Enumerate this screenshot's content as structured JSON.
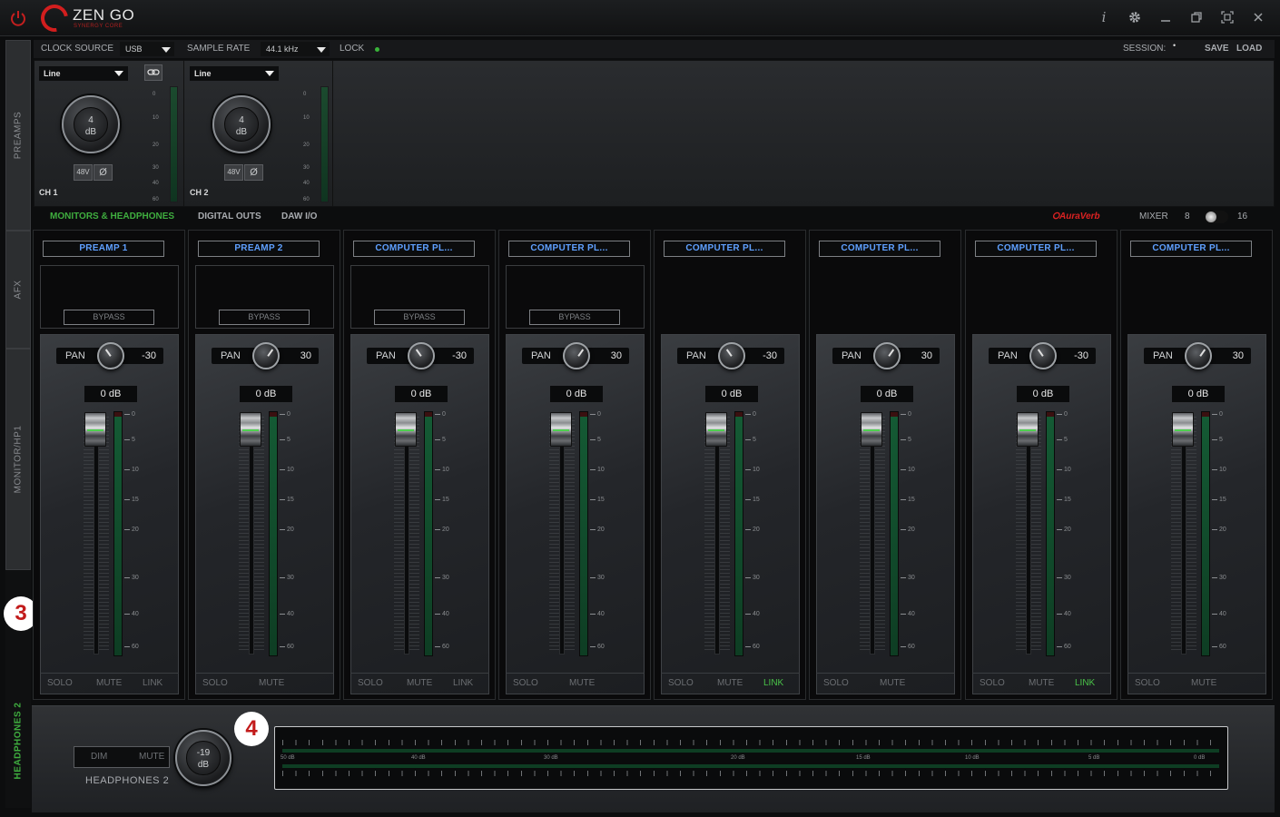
{
  "app": {
    "logo_text": "ZEN GO",
    "logo_sub": "SYNERGY CORE",
    "window_buttons": [
      "info-icon",
      "gear-icon",
      "minimize-icon",
      "restore-icon",
      "fullscreen-icon",
      "close-icon"
    ]
  },
  "sidebar": {
    "tabs": [
      {
        "label": "PREAMPS"
      },
      {
        "label": "AFX"
      },
      {
        "label": "MONITOR/HP1"
      },
      {
        "label": "HEADPHONES 2"
      }
    ]
  },
  "callouts": {
    "a": "3",
    "b": "4"
  },
  "controlbar": {
    "clock_source_label": "CLOCK SOURCE",
    "clock_source_value": "USB",
    "sample_rate_label": "SAMPLE RATE",
    "sample_rate_value": "44.1 kHz",
    "lock_label": "LOCK",
    "session_label": "SESSION:",
    "save_label": "SAVE",
    "load_label": "LOAD"
  },
  "preamps": [
    {
      "input": "Line",
      "gain": "4",
      "unit": "dB",
      "phantom": "48V",
      "phase": "Ø",
      "label": "CH 1"
    },
    {
      "input": "Line",
      "gain": "4",
      "unit": "dB",
      "phantom": "48V",
      "phase": "Ø",
      "label": "CH 2"
    }
  ],
  "preamp_scale": [
    "0",
    "10",
    "20",
    "30",
    "40",
    "60"
  ],
  "section_tabs": {
    "monitors": "MONITORS & HEADPHONES",
    "digital": "DIGITAL OUTS",
    "daw": "DAW I/O",
    "auraverb": "AuraVerb",
    "mixer_label": "MIXER",
    "mixer_8": "8",
    "mixer_16": "16"
  },
  "strips": [
    {
      "name": "PREAMP 1",
      "bypass": "BYPASS",
      "pan_label": "PAN",
      "pan": "-30",
      "gain": "0 dB",
      "solo": "SOLO",
      "mute": "MUTE",
      "link": "LINK",
      "link_on": false
    },
    {
      "name": "PREAMP 2",
      "bypass": "BYPASS",
      "pan_label": "PAN",
      "pan": "30",
      "gain": "0 dB",
      "solo": "SOLO",
      "mute": "MUTE",
      "link": "",
      "link_on": false
    },
    {
      "name": "COMPUTER PL...",
      "bypass": "BYPASS",
      "pan_label": "PAN",
      "pan": "-30",
      "gain": "0 dB",
      "solo": "SOLO",
      "mute": "MUTE",
      "link": "LINK",
      "link_on": false
    },
    {
      "name": "COMPUTER PL...",
      "bypass": "BYPASS",
      "pan_label": "PAN",
      "pan": "30",
      "gain": "0 dB",
      "solo": "SOLO",
      "mute": "MUTE",
      "link": "",
      "link_on": false
    },
    {
      "name": "COMPUTER PL...",
      "bypass": "",
      "pan_label": "PAN",
      "pan": "-30",
      "gain": "0 dB",
      "solo": "SOLO",
      "mute": "MUTE",
      "link": "LINK",
      "link_on": true
    },
    {
      "name": "COMPUTER PL...",
      "bypass": "",
      "pan_label": "PAN",
      "pan": "30",
      "gain": "0 dB",
      "solo": "SOLO",
      "mute": "MUTE",
      "link": "",
      "link_on": false
    },
    {
      "name": "COMPUTER PL...",
      "bypass": "",
      "pan_label": "PAN",
      "pan": "-30",
      "gain": "0 dB",
      "solo": "SOLO",
      "mute": "MUTE",
      "link": "LINK",
      "link_on": true
    },
    {
      "name": "COMPUTER PL...",
      "bypass": "",
      "pan_label": "PAN",
      "pan": "30",
      "gain": "0 dB",
      "solo": "SOLO",
      "mute": "MUTE",
      "link": "",
      "link_on": false
    }
  ],
  "fader_scale": [
    "0",
    "5",
    "10",
    "15",
    "20",
    "30",
    "40",
    "60"
  ],
  "headphones": {
    "dim": "DIM",
    "mute": "MUTE",
    "label": "HEADPHONES 2",
    "level": "-19",
    "unit": "dB",
    "meter_labels": [
      "50 dB",
      "40 dB",
      "30 dB",
      "20 dB",
      "15 dB",
      "10 dB",
      "5 dB",
      "0 dB"
    ]
  },
  "colors": {
    "accent_green": "#3fae3f",
    "name_blue": "#5fa0ff",
    "brand_red": "#d21e1e"
  }
}
